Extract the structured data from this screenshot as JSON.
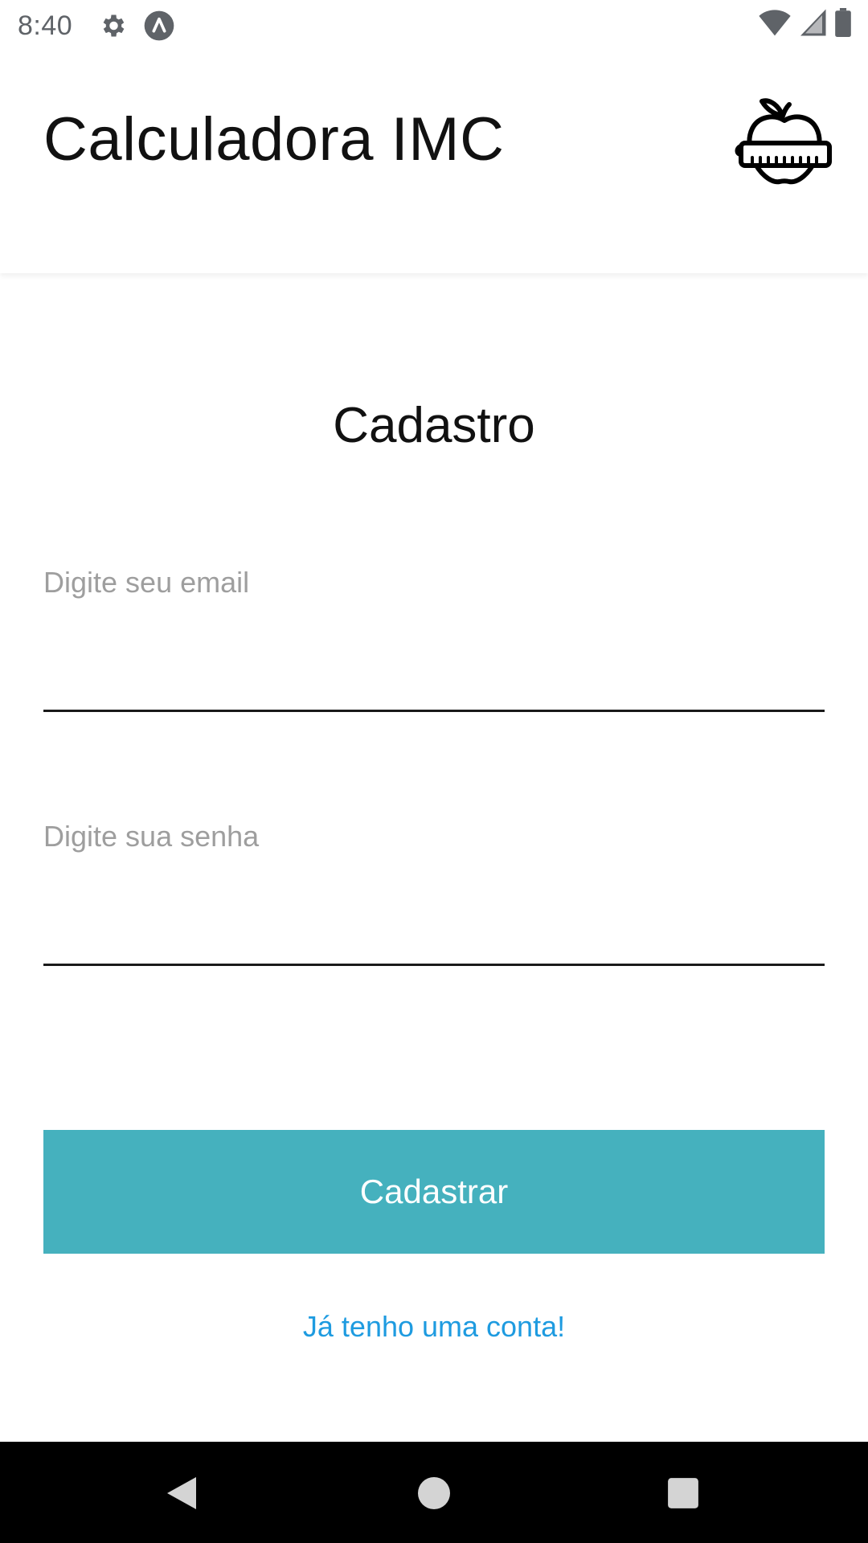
{
  "status_bar": {
    "time": "8:40",
    "icons": [
      "settings-gear-icon",
      "app-notification-icon",
      "wifi-icon",
      "signal-icon",
      "battery-icon"
    ]
  },
  "app_bar": {
    "title": "Calculadora IMC",
    "logo_icon": "apple-measuring-tape-icon"
  },
  "form": {
    "title": "Cadastro",
    "email": {
      "label": "Digite seu email",
      "value": ""
    },
    "password": {
      "label": "Digite sua senha",
      "value": ""
    },
    "submit_label": "Cadastrar",
    "login_link": "Já tenho uma conta!"
  },
  "nav_bar": {
    "icons": [
      "back-icon",
      "home-icon",
      "recents-icon"
    ]
  },
  "colors": {
    "primary_button": "#45b1be",
    "link": "#1e9be0",
    "text": "#111111",
    "placeholder": "#9e9e9e"
  }
}
